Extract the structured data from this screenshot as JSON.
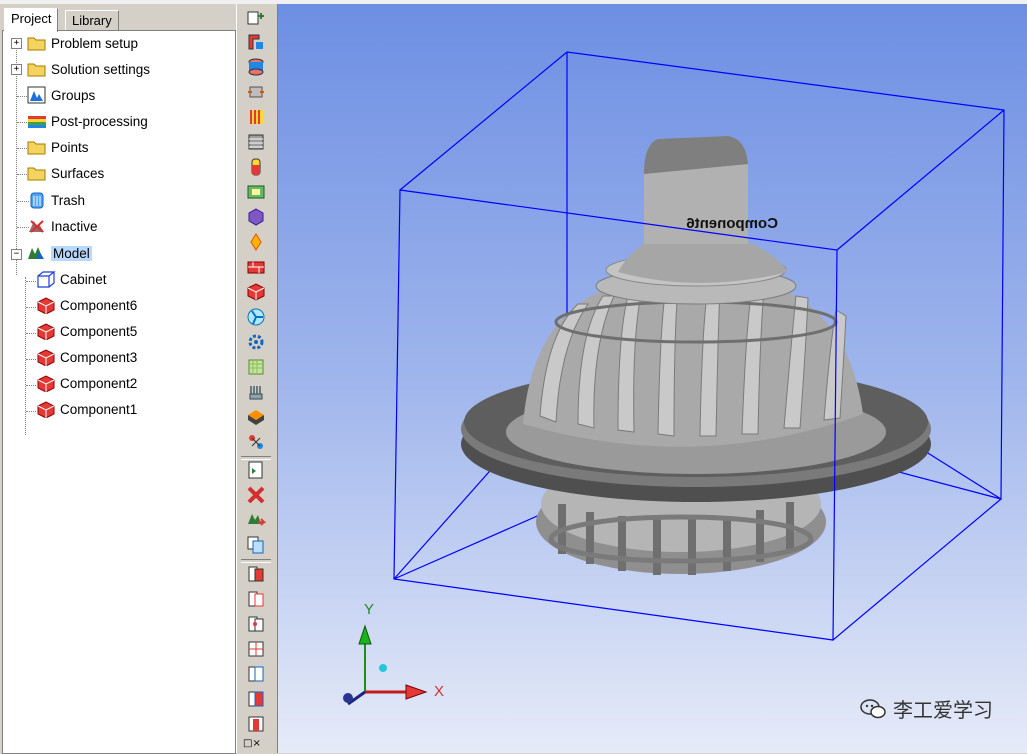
{
  "tabs": {
    "project": "Project",
    "library": "Library"
  },
  "tree": {
    "problem_setup": "Problem setup",
    "solution_settings": "Solution settings",
    "groups": "Groups",
    "post_processing": "Post-processing",
    "points": "Points",
    "surfaces": "Surfaces",
    "trash": "Trash",
    "inactive": "Inactive",
    "model": "Model",
    "children": [
      "Cabinet",
      "Component6",
      "Component5",
      "Component3",
      "Component2",
      "Component1"
    ]
  },
  "viewport": {
    "object_label": "Component6",
    "axis_y": "Y",
    "axis_x": "X"
  },
  "toolbar": {
    "close": "□×"
  },
  "watermark": {
    "text": "李工爱学习"
  },
  "colors": {
    "box_outline": "#0000ff",
    "model_gray": "#a8a8a8",
    "selection": "#b9d8ff"
  }
}
